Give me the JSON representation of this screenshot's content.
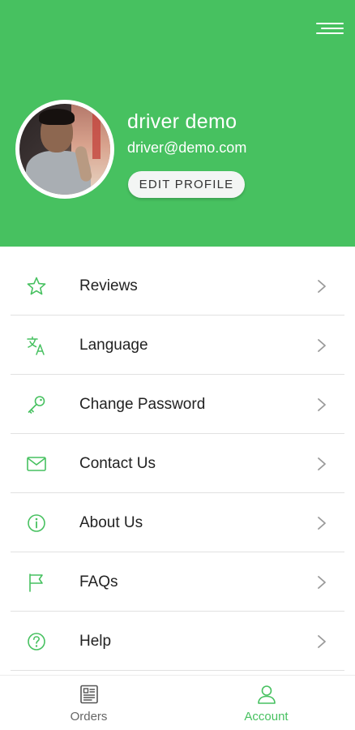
{
  "header": {
    "menu_icon": "hamburger-menu-icon",
    "colors": {
      "background": "#47c160",
      "text": "#ffffff"
    }
  },
  "profile": {
    "name": "driver demo",
    "email": "driver@demo.com",
    "edit_label": "EDIT PROFILE",
    "avatar": "user-photo"
  },
  "menu": {
    "items": [
      {
        "label": "Reviews",
        "icon": "star-icon"
      },
      {
        "label": "Language",
        "icon": "translate-icon"
      },
      {
        "label": "Change Password",
        "icon": "key-icon"
      },
      {
        "label": "Contact Us",
        "icon": "mail-icon"
      },
      {
        "label": "About Us",
        "icon": "info-icon"
      },
      {
        "label": "FAQs",
        "icon": "flag-icon"
      },
      {
        "label": "Help",
        "icon": "help-icon"
      }
    ],
    "chevron_icon": "chevron-right-icon",
    "colors": {
      "icon": "#47c160",
      "text": "#222222",
      "chevron": "#9a9a9a",
      "divider": "#e1e1e1"
    }
  },
  "bottom_nav": {
    "tabs": [
      {
        "label": "Orders",
        "icon": "orders-icon",
        "active": false
      },
      {
        "label": "Account",
        "icon": "account-icon",
        "active": true
      }
    ],
    "colors": {
      "active": "#47c160",
      "inactive": "#666666"
    }
  }
}
